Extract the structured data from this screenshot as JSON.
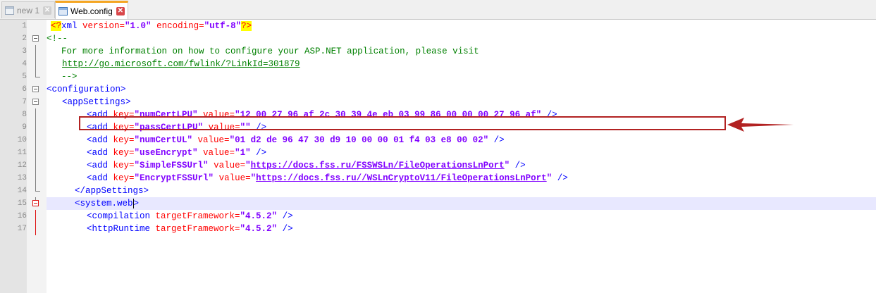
{
  "tabs": [
    {
      "label": "new 1",
      "active": false,
      "close": "✕"
    },
    {
      "label": "Web.config",
      "active": true,
      "close": "✕"
    }
  ],
  "colors": {
    "annotation": "#b22222",
    "tab_accent": "#f5a623"
  },
  "lines": [
    {
      "num": "1"
    },
    {
      "num": "2"
    },
    {
      "num": "3"
    },
    {
      "num": "4"
    },
    {
      "num": "5"
    },
    {
      "num": "6"
    },
    {
      "num": "7"
    },
    {
      "num": "8"
    },
    {
      "num": "9"
    },
    {
      "num": "10"
    },
    {
      "num": "11"
    },
    {
      "num": "12"
    },
    {
      "num": "13"
    },
    {
      "num": "14"
    },
    {
      "num": "15"
    },
    {
      "num": "16"
    },
    {
      "num": "17"
    }
  ],
  "code": {
    "l1": {
      "pi_open": "<?",
      "tag": "xml",
      "attr1": " version=",
      "val1": "\"1.0\"",
      "attr2": " encoding=",
      "val2": "\"utf-8\"",
      "pi_close": "?>"
    },
    "l2": {
      "text": "<!--"
    },
    "l3": {
      "text": "  For more information on how to configure your ASP.NET application, please visit"
    },
    "l4": {
      "link": "http://go.microsoft.com/fwlink/?LinkId=301879"
    },
    "l5": {
      "text": "  -->"
    },
    "l6": {
      "tag": "<configuration>"
    },
    "l7": {
      "tag": "<appSettings>"
    },
    "l8": {
      "open": "<add",
      "k": " key=",
      "kv": "\"numCertLPU\"",
      "v": " value=",
      "vv": "\"12 00 27 96 af 2c 30 39 4e eb 03 99 86 00 00 00 27 96 af\"",
      "close": " />"
    },
    "l9": {
      "open": "<add",
      "k": " key=",
      "kv": "\"passCertLPU\"",
      "v": " value=",
      "vv": "\"\"",
      "close": " />"
    },
    "l10": {
      "open": "<add",
      "k": " key=",
      "kv": "\"numCertUL\"",
      "v": " value=",
      "vv": "\"01 d2 de 96 47 30 d9 10 00 00 01 f4 03 e8 00 02\"",
      "close": " />"
    },
    "l11": {
      "open": "<add",
      "k": " key=",
      "kv": "\"useEncrypt\"",
      "v": " value=",
      "vv": "\"1\"",
      "close": " />"
    },
    "l12": {
      "open": "<add",
      "k": " key=",
      "kv": "\"SimpleFSSUrl\"",
      "v": " value=",
      "q1": "\"",
      "url": "https://docs.fss.ru/FSSWSLn/FileOperationsLnPort",
      "q2": "\"",
      "close": " />"
    },
    "l13": {
      "open": "<add",
      "k": " key=",
      "kv": "\"EncryptFSSUrl\"",
      "v": " value=",
      "q1": "\"",
      "url": "https://docs.fss.ru//WSLnCryptoV11/FileOperationsLnPort",
      "q2": "\"",
      "close": " />"
    },
    "l14": {
      "tag": "</appSettings>"
    },
    "l15": {
      "tag": "<system.web",
      "tag_close": ">"
    },
    "l16": {
      "open": "<compilation",
      "a": " targetFramework=",
      "av": "\"4.5.2\"",
      "close": " />"
    },
    "l17": {
      "open": "<httpRuntime",
      "a": " targetFramework=",
      "av": "\"4.5.2\"",
      "close": " />"
    }
  }
}
